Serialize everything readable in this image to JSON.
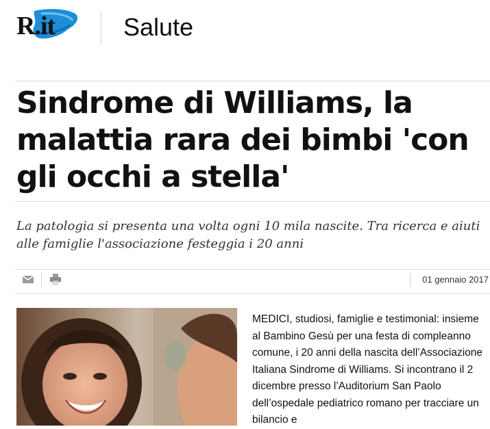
{
  "header": {
    "logo_text": "R.it",
    "section": "Salute"
  },
  "article": {
    "headline": "Sindrome di Williams, la malattia rara dei bimbi 'con gli occhi a stella'",
    "subtitle": "La patologia si presenta una volta ogni 10 mila nascite. Tra ricerca e aiuti alle famiglie l'associazione festeggia i 20 anni",
    "date": "01 gennaio 2017",
    "body": "MEDICI, studiosi, famiglie e testimonial: insieme al Bambino Gesù per una festa di compleanno comune, i 20 anni della nascita dell’Associazione Italiana Sindrome di Williams. Si incontrano il  2 dicembre presso l’Auditorium San Paolo dell’ospedale pediatrico romano per tracciare un bilancio e"
  },
  "tools": [
    {
      "icon": "mail-icon"
    },
    {
      "icon": "print-icon"
    }
  ],
  "colors": {
    "logo_brush": "#1e8ed6",
    "rule": "#d9d9d9",
    "text": "#111111"
  }
}
